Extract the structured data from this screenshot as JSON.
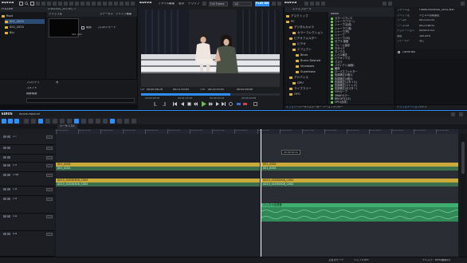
{
  "colors": {
    "accent": "#2f8fff",
    "video_clip": "#c9a93a",
    "audio_clip": "#3d6f4c",
    "audio_clip2": "#3fae6e",
    "selection": "#f0c020"
  },
  "app": {
    "name": "EDIUS",
    "play_rec": "PLAY REC",
    "menus": [
      "ファイル",
      "編集",
      "表示",
      "クリップ"
    ],
    "frame_mode": "Full Frame",
    "frame_value": "1/2",
    "search_value": "1/4"
  },
  "bin": {
    "title": "FOLDER",
    "path": "D:¥EDIUS_2023¥ビン",
    "columns": [
      "クリップ名",
      "ステータス",
      "クリップ種類"
    ],
    "tree": [
      "Root",
      "001_2023",
      "002_2023",
      "Bin"
    ],
    "clip_name": "001_001",
    "checkbox_label": "開発",
    "thumb_label": "プロキシモード",
    "props": [
      {
        "label": "プロパティ",
        "value": "有"
      },
      {
        "label": "コメント",
        "value": ""
      },
      {
        "label": "総解像度",
        "value": ""
      }
    ]
  },
  "player": {
    "in_label": "Cur",
    "in_tc": "00:00:48:28",
    "dur_tc": "00:21:45:05",
    "out_label": "Out",
    "out_tc": "00:24:45:05",
    "total_tc": "00:00:00:00",
    "timecodes2": [
      "00:00:48:18",
      "00:01:25:00",
      "00:00:00:15",
      "00:00:00:05"
    ]
  },
  "source_browser": {
    "title": "エクスプローラ",
    "tree": [
      "デスクトップ",
      "PC",
      "デジタルカメラ",
      "カラーコレクション",
      "ビデオフォルダー",
      "ビデオ",
      "エフェクト",
      "Blurs",
      "Burns Dashed",
      "Vicessses",
      "Superboss",
      "アドバンス",
      "GPU",
      "ライブラリー",
      "GFG"
    ],
    "files_header": "Name",
    "files": [
      "カラーバランス",
      "シャープ(ブラー)",
      "シャープ(合成)",
      "シャープ(三角)",
      "シャープ(円)",
      "シャープ",
      "シャープ(3X)",
      "ゼブラ-基礎",
      "フレーム保存",
      "モザイク",
      "モノクロ",
      "レベル補正",
      "ビデオノイズ",
      "マスク",
      "メディアン(画像)",
      "輪郭",
      "ローパスフィルター",
      "色調補正(2度1)",
      "色調補正(4度1)",
      "色調補正(スタイル)",
      "色調補正(ストレス)",
      "色調補正(ポスター)",
      "YUVカーブ",
      "3WAYカラー",
      "BRIGHT(1/2)",
      "GPU(合成)"
    ],
    "bottom_tabs": [
      "エフェクト",
      "シーケンスマーカー",
      "ソースブラウザー"
    ]
  },
  "info": {
    "rows": [
      {
        "label": "ファイル名",
        "value": "F:¥ARCHIVE¥001_0001.MXF"
      },
      {
        "label": "クリップ名",
        "value": "ジェネル合成設定"
      },
      {
        "label": "ソースIn",
        "value": "00:21:01:51"
      },
      {
        "label": "ソースOut",
        "value": "00:21:48:52"
      },
      {
        "label": "デュレーション",
        "value": "00:00:47:01"
      },
      {
        "label": "速度",
        "value": "100.00%"
      },
      {
        "label": "フィールド",
        "value": "なし"
      }
    ],
    "effect_name": "Cache BKI",
    "tabs": [
      "インフォメーション",
      "ツイン"
    ]
  },
  "timeline": {
    "title": "EDIUS",
    "sequence_name": "MOVIE-PAINTER",
    "tab": "シーケンス1",
    "playhead_tc": "00:00:54:21",
    "ruler": [
      "00:00:00:00",
      "00:00:05:00",
      "00:00:10:00",
      "00:00:15:00",
      "00:00:20:00",
      "00:00:25:00",
      "00:00:30:00",
      "00:00:35:00",
      "00:00:40:00",
      "00:00:45:00",
      "00:00:50:00",
      "00:00:55:00",
      "00:01:00:00",
      "00:01:05:00",
      "00:01:10:00",
      "00:01:15:00",
      "00:01:20:00",
      "00:01:25:00"
    ],
    "tracks": [
      {
        "name": "1 T",
        "type": "title"
      },
      {
        "name": "",
        "type": "empty"
      },
      {
        "name": "",
        "type": "empty"
      },
      {
        "name": "2 V",
        "type": "video"
      },
      {
        "name": "1 VA",
        "type": "videoaudio"
      },
      {
        "name": "1 A",
        "type": "audio"
      },
      {
        "name": "2 A",
        "type": "audio"
      },
      {
        "name": "3 A",
        "type": "audio"
      },
      {
        "name": "4 A",
        "type": "audio"
      }
    ],
    "clips": {
      "v2_left": "001_0001",
      "v2_left_sub": "001_0001",
      "v2_right": "001_0001",
      "v2_right_sub": "001_0001",
      "va_left": "A013_02030308_C002",
      "va_left_sub": "A013_02030308_C002",
      "va_right": "A013_02030308_C002",
      "va_right_sub": "A013_02030308_C002",
      "audio_right": "ジェネル合成音"
    },
    "status": [
      "上書きモード",
      "リップルOFF",
      "ディスク：85%(使用中)"
    ]
  }
}
